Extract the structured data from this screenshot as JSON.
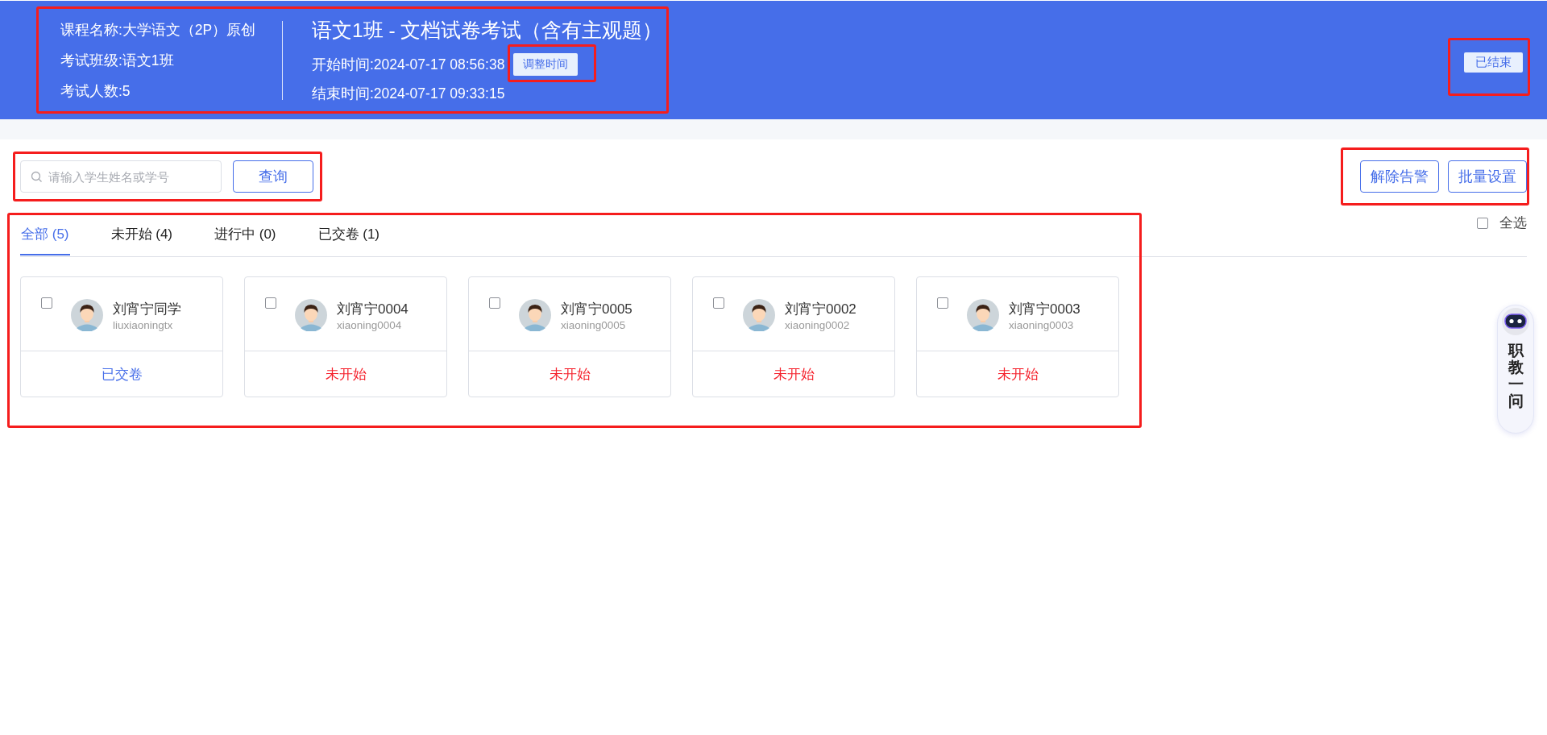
{
  "header": {
    "course": "课程名称:大学语文（2P）原创",
    "class": "考试班级:语文1班",
    "count": "考试人数:5",
    "title": "语文1班 - 文档试卷考试（含有主观题）",
    "start": "开始时间:2024-07-17 08:56:38",
    "adjust_button": "调整时间",
    "end": "结束时间:2024-07-17 09:33:15",
    "status": "已结束"
  },
  "search": {
    "placeholder": "请输入学生姓名或学号",
    "button": "查询"
  },
  "actions": [
    "解除告警",
    "批量设置"
  ],
  "tabs": [
    {
      "label": "全部 (5)",
      "selected": true
    },
    {
      "label": "未开始 (4)",
      "selected": false
    },
    {
      "label": "进行中 (0)",
      "selected": false
    },
    {
      "label": "已交卷 (1)",
      "selected": false
    }
  ],
  "select_all": {
    "label": "全选",
    "checked": false
  },
  "students": [
    {
      "name": "刘宵宁同学",
      "account": "liuxiaoningtx",
      "checked": false,
      "kind": "submitted",
      "status": "已交卷"
    },
    {
      "name": "刘宵宁0004",
      "account": "xiaoning0004",
      "checked": false,
      "kind": "not_started",
      "status": "未开始"
    },
    {
      "name": "刘宵宁0005",
      "account": "xiaoning0005",
      "checked": false,
      "kind": "not_started",
      "status": "未开始"
    },
    {
      "name": "刘宵宁0002",
      "account": "xiaoning0002",
      "checked": false,
      "kind": "not_started",
      "status": "未开始"
    },
    {
      "name": "刘宵宁0003",
      "account": "xiaoning0003",
      "checked": false,
      "kind": "not_started",
      "status": "未开始"
    }
  ],
  "assistant": {
    "label": "职教一问"
  }
}
